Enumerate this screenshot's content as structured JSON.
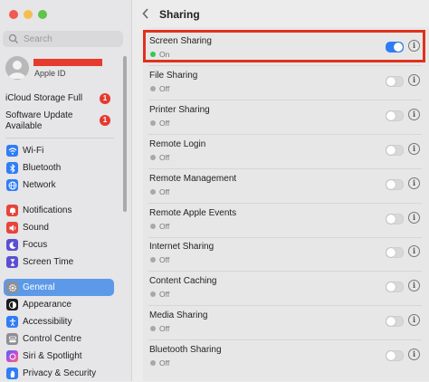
{
  "window": {
    "traffic_lights": [
      "#ee5b52",
      "#f5be4f",
      "#5dc44c"
    ]
  },
  "sidebar": {
    "search_placeholder": "Search",
    "profile": {
      "apple_id_label": "Apple ID"
    },
    "notices": [
      {
        "label": "iCloud Storage Full",
        "badge": "1"
      },
      {
        "label": "Software Update Available",
        "badge": "1"
      }
    ],
    "groups": [
      [
        {
          "label": "Wi-Fi",
          "icon": "wifi-icon",
          "color": "#2f7df6"
        },
        {
          "label": "Bluetooth",
          "icon": "bluetooth-icon",
          "color": "#2f7df6"
        },
        {
          "label": "Network",
          "icon": "globe-icon",
          "color": "#2f7df6"
        }
      ],
      [
        {
          "label": "Notifications",
          "icon": "bell-icon",
          "color": "#e5453a"
        },
        {
          "label": "Sound",
          "icon": "speaker-icon",
          "color": "#e5453a"
        },
        {
          "label": "Focus",
          "icon": "moon-icon",
          "color": "#5a4fd1"
        },
        {
          "label": "Screen Time",
          "icon": "hourglass-icon",
          "color": "#5a4fd1"
        }
      ],
      [
        {
          "label": "General",
          "icon": "gear-icon",
          "color": "#8e8e93",
          "selected": true
        },
        {
          "label": "Appearance",
          "icon": "appearance-icon",
          "color": "#1c1c1e"
        },
        {
          "label": "Accessibility",
          "icon": "accessibility-icon",
          "color": "#2f7df6"
        },
        {
          "label": "Control Centre",
          "icon": "control-centre-icon",
          "color": "#8e8e93"
        },
        {
          "label": "Siri & Spotlight",
          "icon": "siri-icon",
          "color": "#c24bd6"
        },
        {
          "label": "Privacy & Security",
          "icon": "hand-icon",
          "color": "#2f7df6"
        }
      ]
    ]
  },
  "header": {
    "title": "Sharing"
  },
  "services": [
    {
      "name": "Screen Sharing",
      "status": "On",
      "enabled": true
    },
    {
      "name": "File Sharing",
      "status": "Off",
      "enabled": false
    },
    {
      "name": "Printer Sharing",
      "status": "Off",
      "enabled": false
    },
    {
      "name": "Remote Login",
      "status": "Off",
      "enabled": false
    },
    {
      "name": "Remote Management",
      "status": "Off",
      "enabled": false
    },
    {
      "name": "Remote Apple Events",
      "status": "Off",
      "enabled": false
    },
    {
      "name": "Internet Sharing",
      "status": "Off",
      "enabled": false
    },
    {
      "name": "Content Caching",
      "status": "Off",
      "enabled": false
    },
    {
      "name": "Media Sharing",
      "status": "Off",
      "enabled": false
    },
    {
      "name": "Bluetooth Sharing",
      "status": "Off",
      "enabled": false
    }
  ],
  "status_colors": {
    "on": "#34c759",
    "off": "#a8a8a8"
  },
  "info_glyph": "i"
}
